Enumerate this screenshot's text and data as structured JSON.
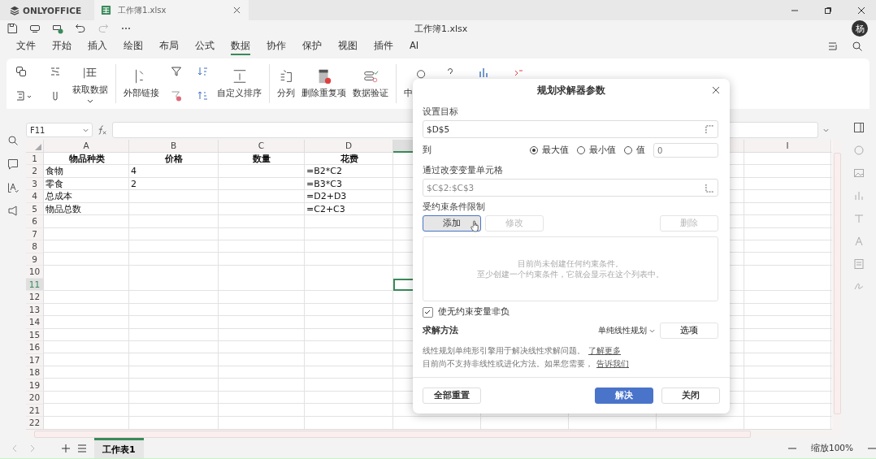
{
  "app": {
    "brand": "ONLYOFFICE",
    "doc_tab": "工作簿1.xlsx",
    "title": "工作簿1.xlsx",
    "avatar": "杨"
  },
  "menu": [
    {
      "label": "文件",
      "selected": false
    },
    {
      "label": "开始",
      "selected": false
    },
    {
      "label": "插入",
      "selected": false
    },
    {
      "label": "绘图",
      "selected": false
    },
    {
      "label": "布局",
      "selected": false
    },
    {
      "label": "公式",
      "selected": false
    },
    {
      "label": "数据",
      "selected": true
    },
    {
      "label": "协作",
      "selected": false
    },
    {
      "label": "保护",
      "selected": false
    },
    {
      "label": "视图",
      "selected": false
    },
    {
      "label": "插件",
      "selected": false
    },
    {
      "label": "AI",
      "selected": false
    }
  ],
  "ribbon": {
    "buttons": [
      {
        "label": "获取数据",
        "kind": "get-data"
      },
      {
        "label": "外部链接",
        "kind": "external-links"
      },
      {
        "label": "自定义排序",
        "kind": "custom-sort"
      },
      {
        "label": "分列",
        "kind": "text-to-columns"
      },
      {
        "label": "删除重复项",
        "kind": "remove-duplicates"
      },
      {
        "label": "数据验证",
        "kind": "data-validation"
      },
      {
        "label": "中",
        "kind": "search-group"
      }
    ]
  },
  "formula_bar": {
    "name_box": "F11"
  },
  "sheet": {
    "columns": [
      {
        "label": "A",
        "selected": false
      },
      {
        "label": "B",
        "selected": false
      },
      {
        "label": "C",
        "selected": false
      },
      {
        "label": "D",
        "selected": false
      },
      {
        "selected": true
      },
      {
        "label": "I",
        "selected": false
      }
    ],
    "rows": [
      {
        "header": "1",
        "selected": false,
        "kind": "heading",
        "cells": {
          "A": "物品种类",
          "B": "价格",
          "C": "数量",
          "D": "花费"
        }
      },
      {
        "header": "2",
        "selected": false,
        "kind": "data",
        "cells": {
          "A": "食物",
          "B": "4",
          "D": "=B2*C2"
        }
      },
      {
        "header": "3",
        "selected": false,
        "kind": "data",
        "cells": {
          "A": "零食",
          "B": "2",
          "D": "=B3*C3"
        }
      },
      {
        "header": "4",
        "selected": false,
        "kind": "data",
        "cells": {
          "A": "总成本",
          "D": "=D2+D3"
        }
      },
      {
        "header": "5",
        "selected": false,
        "kind": "data",
        "cells": {
          "A": "物品总数",
          "D": "=C2+C3"
        }
      },
      {
        "header": "6",
        "selected": false
      },
      {
        "header": "7",
        "selected": false
      },
      {
        "header": "8",
        "selected": false
      },
      {
        "header": "9",
        "selected": false
      },
      {
        "header": "10",
        "selected": false
      },
      {
        "header": "11",
        "selected": true
      },
      {
        "header": "12",
        "selected": false
      },
      {
        "header": "13",
        "selected": false
      },
      {
        "header": "14",
        "selected": false
      },
      {
        "header": "15",
        "selected": false
      },
      {
        "header": "16",
        "selected": false
      },
      {
        "header": "17",
        "selected": false
      },
      {
        "header": "18",
        "selected": false
      },
      {
        "header": "19",
        "selected": false
      },
      {
        "header": "20",
        "selected": false
      },
      {
        "header": "21",
        "selected": false
      },
      {
        "header": "22",
        "selected": false
      }
    ]
  },
  "sheet_tabs": [
    {
      "label": "工作表1",
      "selected": true
    }
  ],
  "zoom": "缩放100%",
  "solver_dialog": {
    "title": "规划求解器参数",
    "objective_label": "设置目标",
    "objective_value": "$D$5",
    "to_label": "到",
    "targets": [
      {
        "label": "最大值",
        "selected": true
      },
      {
        "label": "最小值",
        "selected": false
      },
      {
        "label": "值",
        "selected": false
      }
    ],
    "target_value_placeholder": "0",
    "variables_label": "通过改变变量单元格",
    "variables_value": "$C$2:$C$3",
    "constraints_label": "受约束条件限制",
    "constraint_buttons": [
      {
        "label": "添加",
        "disabled": false
      },
      {
        "label": "修改",
        "disabled": true
      },
      {
        "label": "删除",
        "disabled": true
      }
    ],
    "constraints_empty": [
      "目前尚未创建任何约束条件。",
      "至少创建一个约束条件，它就会显示在这个列表中。"
    ],
    "nonnegative": {
      "label": "使无约束变量非负",
      "checked": true
    },
    "method_label": "求解方法",
    "method_value": "单纯线性规划",
    "options_button": "选项",
    "notes": [
      {
        "text": "线性规划单纯形引擎用于解决线性求解问题。",
        "link": "了解更多"
      },
      {
        "text": "目前尚不支持非线性或进化方法。如果您需要，",
        "link": "告诉我们"
      }
    ],
    "buttons": [
      {
        "label": "全部重置",
        "kind": "secondary"
      },
      {
        "label": "解决",
        "kind": "primary"
      },
      {
        "label": "关闭",
        "kind": "secondary"
      }
    ]
  }
}
